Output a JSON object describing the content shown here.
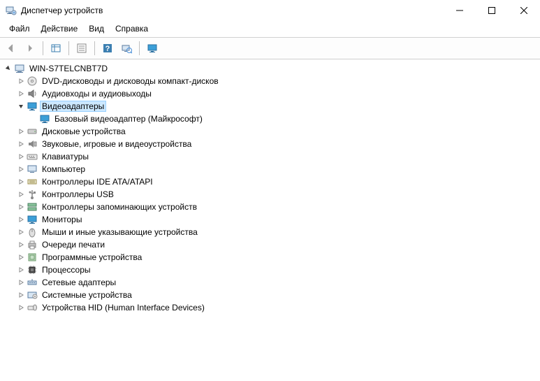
{
  "window": {
    "title": "Диспетчер устройств"
  },
  "menu": {
    "file": "Файл",
    "action": "Действие",
    "view": "Вид",
    "help": "Справка"
  },
  "toolbar": {
    "back": "Назад",
    "forward": "Вперёд",
    "show_hidden": "Показать скрытые",
    "properties": "Свойства",
    "help": "Справка",
    "refresh": "Обновить",
    "monitor": "Мониторы"
  },
  "tree": {
    "root": {
      "label": "WIN-S7TELCNBT7D",
      "expanded": true
    },
    "items": [
      {
        "label": "DVD-дисководы и дисководы компакт-дисков",
        "icon": "disc",
        "expanded": false
      },
      {
        "label": "Аудиовходы и аудиовыходы",
        "icon": "audio",
        "expanded": false
      },
      {
        "label": "Видеоадаптеры",
        "icon": "display",
        "expanded": true,
        "selected": true,
        "children": [
          {
            "label": "Базовый видеоадаптер (Майкрософт)",
            "icon": "display"
          }
        ]
      },
      {
        "label": "Дисковые устройства",
        "icon": "hdd",
        "expanded": false
      },
      {
        "label": "Звуковые, игровые и видеоустройства",
        "icon": "sound",
        "expanded": false
      },
      {
        "label": "Клавиатуры",
        "icon": "keyboard",
        "expanded": false
      },
      {
        "label": "Компьютер",
        "icon": "computer",
        "expanded": false
      },
      {
        "label": "Контроллеры IDE ATA/ATAPI",
        "icon": "ide",
        "expanded": false
      },
      {
        "label": "Контроллеры USB",
        "icon": "usb",
        "expanded": false
      },
      {
        "label": "Контроллеры запоминающих устройств",
        "icon": "storage",
        "expanded": false
      },
      {
        "label": "Мониторы",
        "icon": "monitor",
        "expanded": false
      },
      {
        "label": "Мыши и иные указывающие устройства",
        "icon": "mouse",
        "expanded": false
      },
      {
        "label": "Очереди печати",
        "icon": "printer",
        "expanded": false
      },
      {
        "label": "Программные устройства",
        "icon": "software",
        "expanded": false
      },
      {
        "label": "Процессоры",
        "icon": "cpu",
        "expanded": false
      },
      {
        "label": "Сетевые адаптеры",
        "icon": "network",
        "expanded": false
      },
      {
        "label": "Системные устройства",
        "icon": "system",
        "expanded": false
      },
      {
        "label": "Устройства HID (Human Interface Devices)",
        "icon": "hid",
        "expanded": false
      }
    ]
  }
}
